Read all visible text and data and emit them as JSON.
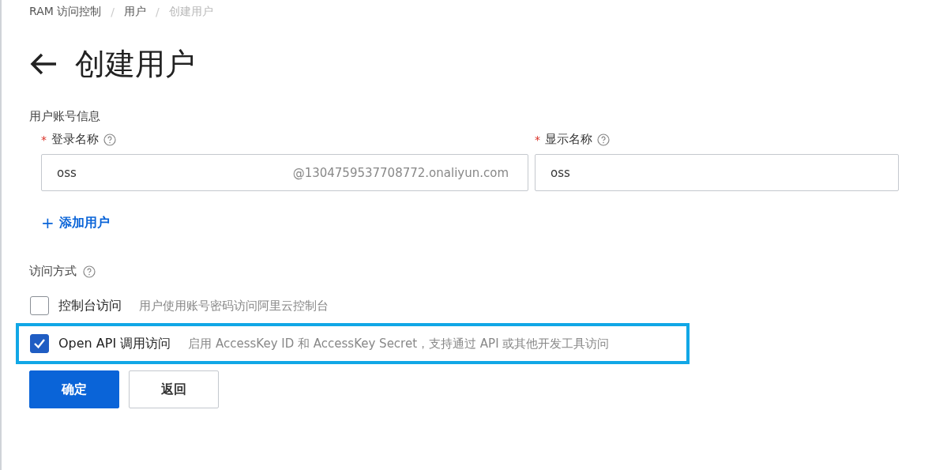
{
  "breadcrumb": [
    {
      "label": "RAM 访问控制",
      "current": false
    },
    {
      "label": "用户",
      "current": false
    },
    {
      "label": "创建用户",
      "current": true
    }
  ],
  "separator": "/",
  "title": "创建用户",
  "account_section": {
    "heading": "用户账号信息",
    "fields": [
      {
        "label": "登录名称",
        "required": true,
        "value": "oss",
        "suffix": "@1304759537708772.onaliyun.com"
      },
      {
        "label": "显示名称",
        "required": true,
        "value": "oss"
      }
    ],
    "required_mark": "*",
    "add_user": {
      "icon": "+",
      "label": "添加用户"
    }
  },
  "access_section": {
    "heading": "访问方式",
    "options": [
      {
        "label": "控制台访问",
        "description": "用户使用账号密码访问阿里云控制台",
        "checked": false,
        "highlighted": false
      },
      {
        "label": "Open API 调用访问",
        "description": "启用 AccessKey ID 和 AccessKey Secret，支持通过 API 或其他开发工具访问",
        "checked": true,
        "highlighted": true
      }
    ]
  },
  "buttons": [
    {
      "label": "确定",
      "kind": "primary"
    },
    {
      "label": "返回",
      "kind": "secondary"
    }
  ]
}
